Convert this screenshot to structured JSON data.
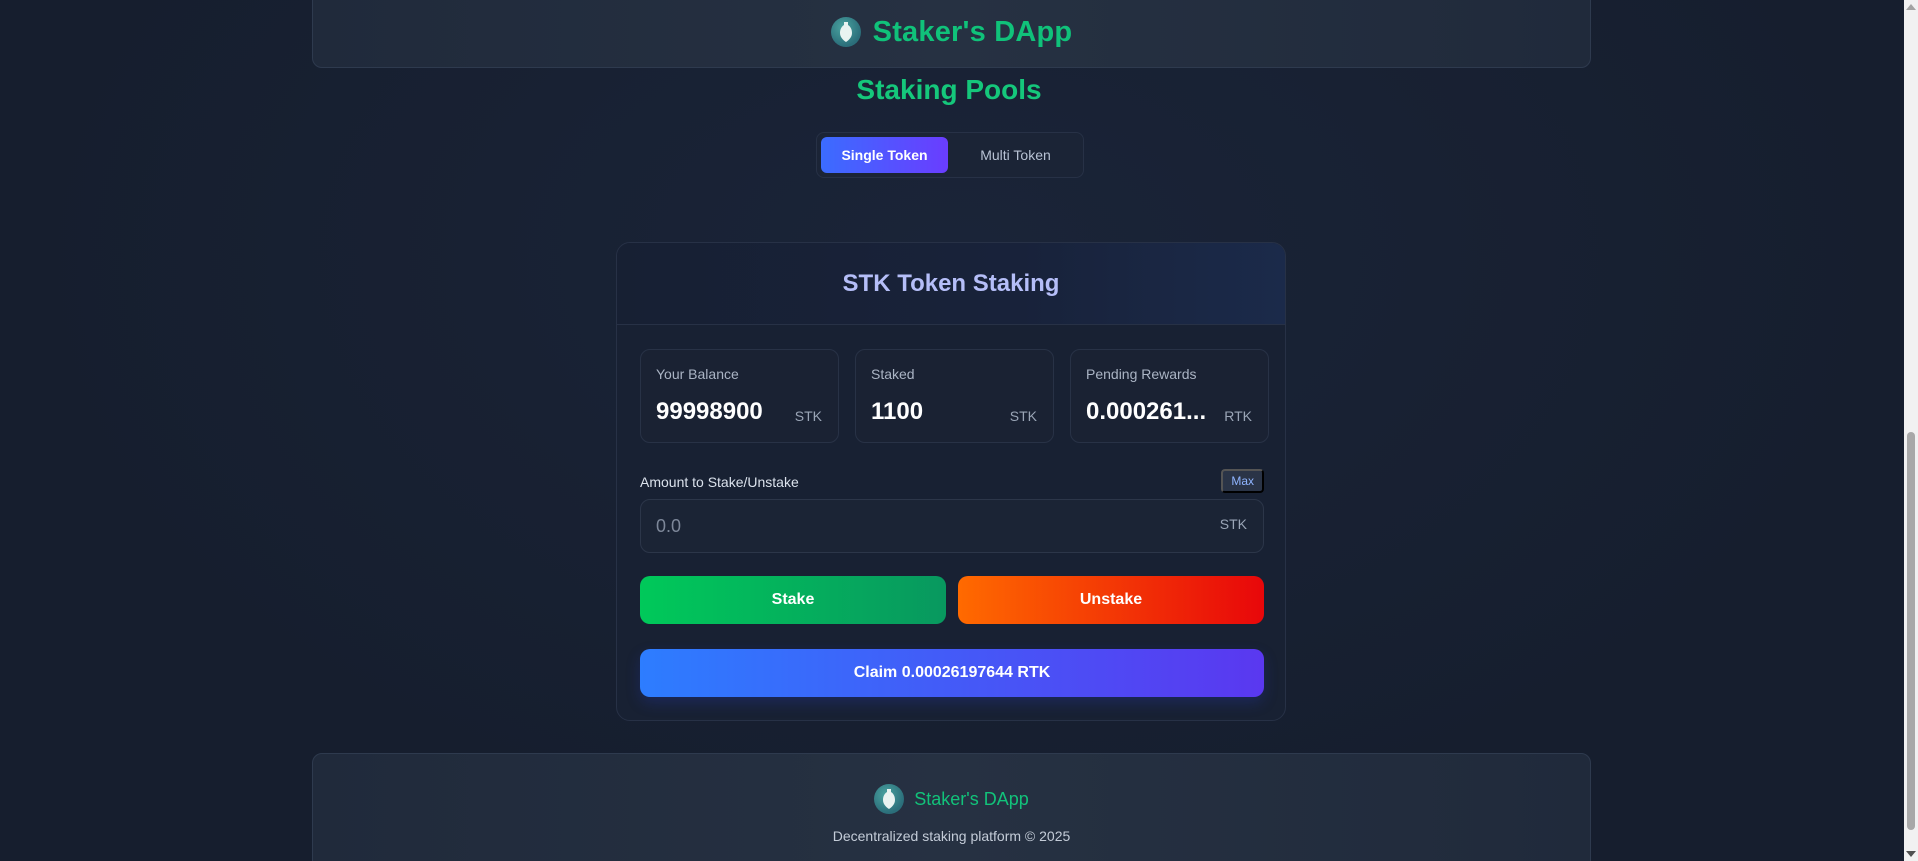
{
  "header": {
    "title": "Staker's DApp",
    "logo_icon": "vase-logo-icon"
  },
  "page_title": "Staking Pools",
  "tabs": [
    {
      "label": "Single Token",
      "active": true
    },
    {
      "label": "Multi Token",
      "active": false
    }
  ],
  "card": {
    "title": "STK Token Staking",
    "stats": [
      {
        "label": "Your Balance",
        "value": "99998900",
        "unit": "STK"
      },
      {
        "label": "Staked",
        "value": "1100",
        "unit": "STK"
      },
      {
        "label": "Pending Rewards",
        "value": "0.000261...",
        "unit": "RTK"
      }
    ],
    "amount_label": "Amount to Stake/Unstake",
    "max_label": "Max",
    "input": {
      "placeholder": "0.0",
      "value": "",
      "unit": "STK"
    },
    "stake_label": "Stake",
    "unstake_label": "Unstake",
    "claim_label": "Claim 0.00026197644 RTK"
  },
  "footer": {
    "title": "Staker's DApp",
    "copyright": "Decentralized staking platform © 2025"
  },
  "colors": {
    "brand_green": "#10c27a",
    "accent_blue": "#3b6cff",
    "accent_purple": "#6a3dff",
    "stake_green": "#00c95a",
    "unstake_orange": "#ff6a00",
    "unstake_red": "#e8070a",
    "background": "#172033"
  }
}
